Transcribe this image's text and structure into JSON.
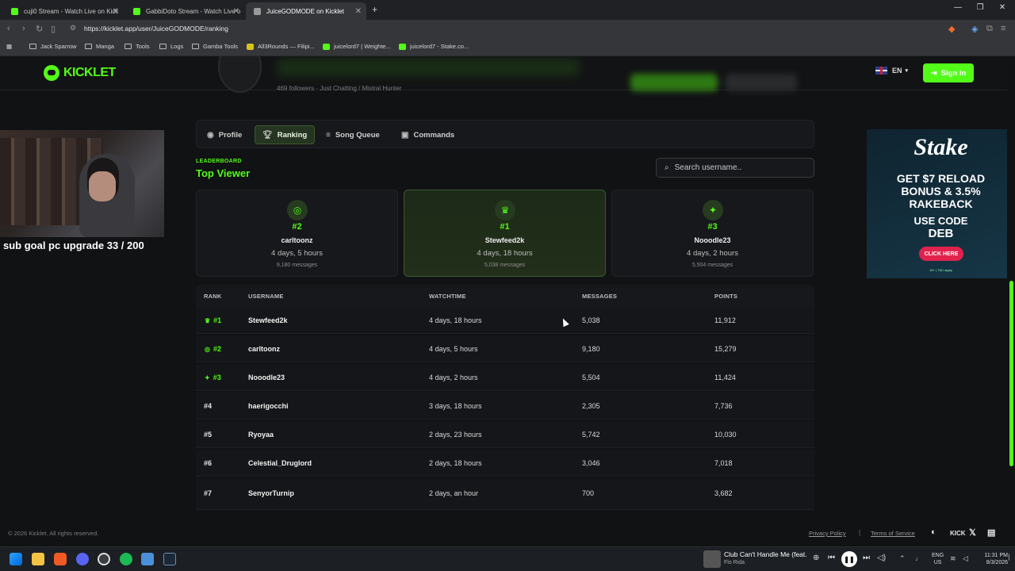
{
  "browser": {
    "tabs": [
      {
        "title": "cuji0 Stream - Watch Live on Kick",
        "active": false
      },
      {
        "title": "GabbiDoto Stream - Watch Live o",
        "active": false
      },
      {
        "title": "JuiceGODMODE on Kicklet",
        "active": true
      }
    ],
    "new_tab_icon": "plus-icon",
    "url": "https://kicklet.app/user/JuiceGODMODE/ranking",
    "bookmarks": [
      "Jack Sparrow",
      "Manga",
      "Tools",
      "Logs",
      "Gamba Tools",
      "All3Rounds — Filipi...",
      "juicelord7 | Weighte...",
      "juicelord7 - Stake.co..."
    ]
  },
  "site": {
    "logo_text": "KICKLET",
    "profile_meta": "469 followers · Just Chatting / Mistral Hunter",
    "lang": "EN",
    "signin_label": "Sign in",
    "overlay_text": "sub goal pc upgrade 33 / 200",
    "tabs": [
      {
        "label": "Profile",
        "icon": "user-circle-icon",
        "active": false
      },
      {
        "label": "Ranking",
        "icon": "trophy-icon",
        "active": true
      },
      {
        "label": "Song Queue",
        "icon": "music-list-icon",
        "active": false
      },
      {
        "label": "Commands",
        "icon": "terminal-icon",
        "active": false
      }
    ],
    "leaderboard_label": "LEADERBOARD",
    "leaderboard_title": "Top Viewer",
    "search_placeholder": "Search username..",
    "podium": [
      {
        "rank": "#2",
        "name": "carltoonz",
        "watchtime": "4 days, 5 hours",
        "messages": "9,180 messages",
        "icon": "medal-icon"
      },
      {
        "rank": "#1",
        "name": "Stewfeed2k",
        "watchtime": "4 days, 18 hours",
        "messages": "5,038 messages",
        "icon": "crown-icon"
      },
      {
        "rank": "#3",
        "name": "Nooodle23",
        "watchtime": "4 days, 2 hours",
        "messages": "5,504 messages",
        "icon": "sparkle-icon"
      }
    ],
    "table_headers": {
      "rank": "RANK",
      "username": "USERNAME",
      "watchtime": "WATCHTIME",
      "messages": "MESSAGES",
      "points": "POINTS"
    },
    "rows": [
      {
        "rank": "#1",
        "username": "Stewfeed2k",
        "watchtime": "4 days, 18 hours",
        "messages": "5,038",
        "points": "11,912"
      },
      {
        "rank": "#2",
        "username": "carltoonz",
        "watchtime": "4 days, 5 hours",
        "messages": "9,180",
        "points": "15,279"
      },
      {
        "rank": "#3",
        "username": "Nooodle23",
        "watchtime": "4 days, 2 hours",
        "messages": "5,504",
        "points": "11,424"
      },
      {
        "rank": "#4",
        "username": "haerigocchi",
        "watchtime": "3 days, 18 hours",
        "messages": "2,305",
        "points": "7,736"
      },
      {
        "rank": "#5",
        "username": "Ryoyaa",
        "watchtime": "2 days, 23 hours",
        "messages": "5,742",
        "points": "10,030"
      },
      {
        "rank": "#6",
        "username": "Celestial_Druglord",
        "watchtime": "2 days, 18 hours",
        "messages": "3,046",
        "points": "7,018"
      },
      {
        "rank": "#7",
        "username": "SenyorTurnip",
        "watchtime": "2 days, an hour",
        "messages": "700",
        "points": "3,682"
      }
    ],
    "ad": {
      "brand": "Stake",
      "line1": "GET $7 RELOAD",
      "line2": "BONUS & 3.5%",
      "line3": "RAKEBACK",
      "line4": "USE CODE",
      "code": "DEB",
      "cta": "CLICK HERE",
      "fine": "18+ | T&C apply"
    },
    "footer": {
      "copyright": "© 2026 Kicklet. All rights reserved.",
      "privacy": "Privacy Policy",
      "sep": "|",
      "terms": "Terms of Service",
      "kick": "KICK"
    }
  },
  "taskbar": {
    "media_title": "Club Can't Handle Me (feat.",
    "media_artist": "Flo Rida",
    "lang1": "ENG",
    "lang2": "US",
    "time": "11:31 PM",
    "date": "8/3/2026"
  },
  "colors": {
    "accent": "#53fc18",
    "background": "#111214",
    "card": "#17181b"
  }
}
